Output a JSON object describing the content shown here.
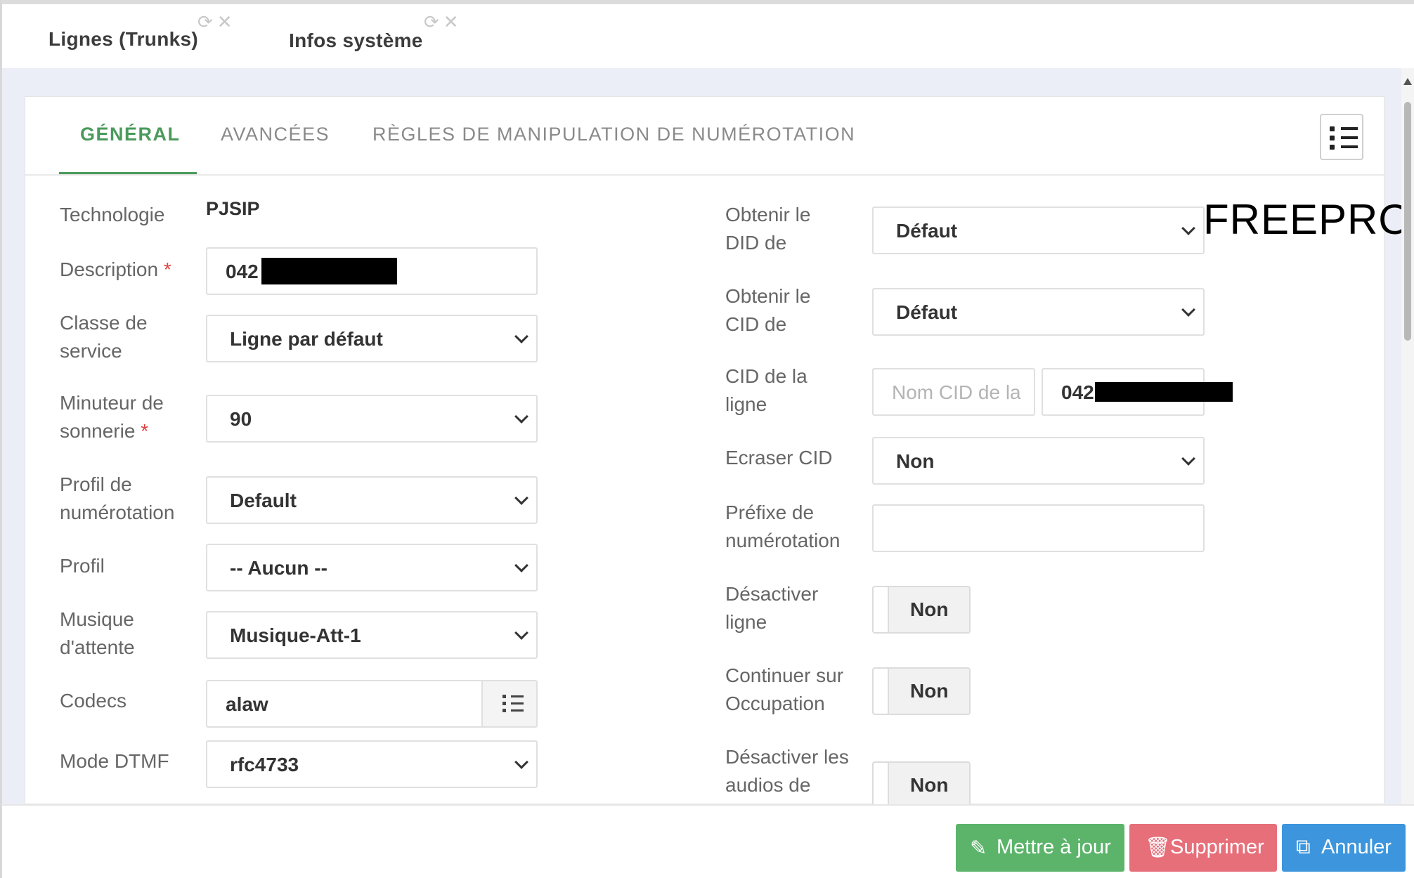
{
  "window_tabs": [
    {
      "label": "Lignes (Trunks)",
      "refresh_icon": "refresh-icon",
      "close_icon": "close-icon"
    },
    {
      "label": "Infos système",
      "refresh_icon": "refresh-icon",
      "close_icon": "close-icon"
    }
  ],
  "tabs": {
    "general": "GÉNÉRAL",
    "advanced": "AVANCÉES",
    "dial_rules": "RÈGLES DE MANIPULATION DE NUMÉROTATION",
    "active": "general"
  },
  "watermark": "FREEPRO",
  "left": {
    "technology": {
      "label": "Technologie",
      "value": "PJSIP"
    },
    "description": {
      "label": "Description",
      "required": "*",
      "value": "042"
    },
    "class_of_service": {
      "label_1": "Classe de",
      "label_2": "service",
      "value": "Ligne par défaut"
    },
    "ring_timer": {
      "label_1": "Minuteur de",
      "label_2": "sonnerie",
      "required": "*",
      "value": "90"
    },
    "dial_profile": {
      "label_1": "Profil de",
      "label_2": "numérotation",
      "value": "Default"
    },
    "profile": {
      "label": "Profil",
      "value": "-- Aucun --"
    },
    "moh": {
      "label_1": "Musique",
      "label_2": "d'attente",
      "value": "Musique-Att-1"
    },
    "codecs": {
      "label": "Codecs",
      "value": "alaw"
    },
    "dtmf": {
      "label": "Mode DTMF",
      "value": "rfc4733"
    }
  },
  "right": {
    "did_from": {
      "label_1": "Obtenir le",
      "label_2": "DID de",
      "value": "Défaut"
    },
    "cid_from": {
      "label_1": "Obtenir le",
      "label_2": "CID de",
      "value": "Défaut"
    },
    "line_cid": {
      "label_1": "CID de la",
      "label_2": "ligne",
      "name_placeholder": "Nom CID de la",
      "number_value": "042"
    },
    "override_cid": {
      "label": "Ecraser CID",
      "value": "Non"
    },
    "dial_prefix": {
      "label_1": "Préfixe de",
      "label_2": "numérotation",
      "value": ""
    },
    "disable_line": {
      "label_1": "Désactiver",
      "label_2": "ligne",
      "value": "Non"
    },
    "continue_busy": {
      "label_1": "Continuer sur",
      "label_2": "Occupation",
      "value": "Non"
    },
    "disable_audio": {
      "label_1": "Désactiver les",
      "label_2": "audios de",
      "value": "Non"
    }
  },
  "footer": {
    "update": "Mettre à jour",
    "delete": "Supprimer",
    "cancel": "Annuler"
  },
  "colors": {
    "accent_green": "#4a9a5c",
    "update_btn": "#5cb46b",
    "delete_btn": "#e66f7a",
    "cancel_btn": "#3d96dd"
  }
}
